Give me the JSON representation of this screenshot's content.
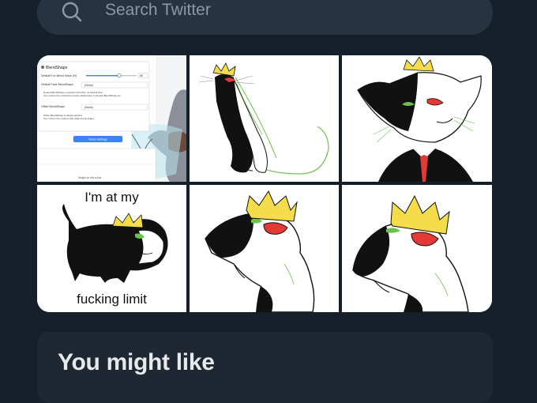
{
  "search": {
    "placeholder": "Search Twitter",
    "icon": "search-icon"
  },
  "media": {
    "tiles": [
      {
        "id": "settings-screenshot",
        "panel_title": "BlendShape",
        "rows": [
          "Default Fun Blend Value (%)",
          "Default Face BlendShape",
          "Neutral BlendShape is applied with blink, as default face.",
          "Use it when the model has custom default face in Neutral BlendShape etc.",
          "Offset BlendShape",
          "Offset BlendShape is always applied.",
          "Use it when the model needs adjust body shape."
        ],
        "slider_value": "80",
        "dropdown_value": "(None)",
        "reset_button": "Reset Settings",
        "footer_note": "Weight on this is fine"
      },
      {
        "id": "cat-sitting"
      },
      {
        "id": "cat-suit"
      },
      {
        "id": "cat-meme",
        "caption_top": "I'm at my",
        "caption_bottom": "fucking limit"
      },
      {
        "id": "cat-profile-1"
      },
      {
        "id": "cat-profile-2"
      }
    ]
  },
  "might_like": {
    "title": "You might like"
  },
  "colors": {
    "background": "#15202b",
    "search_bg": "#273340",
    "card_bg": "#1e2732",
    "text_primary": "#e7e9ea",
    "text_secondary": "#8b98a5",
    "crown": "#f4dc4a",
    "eye_red": "#e53935",
    "cat_green": "#6cc24a"
  }
}
